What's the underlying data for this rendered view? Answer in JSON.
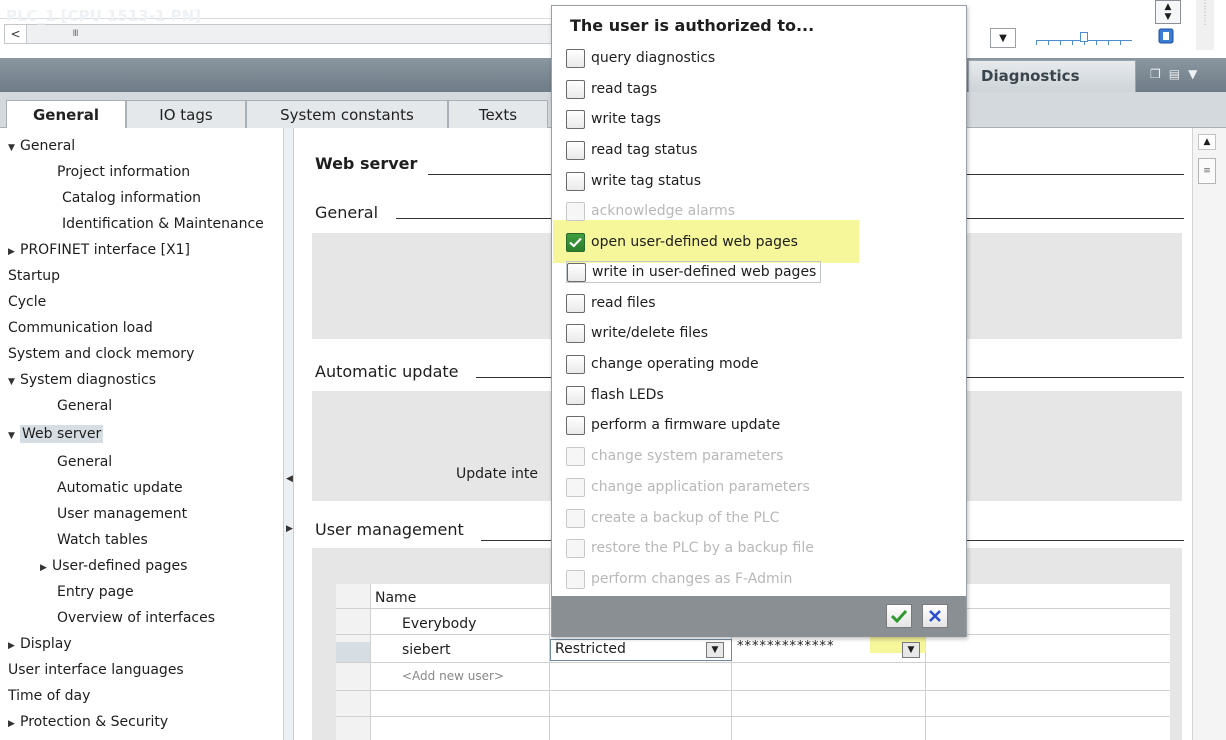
{
  "toolbar": {
    "scroll_left_glyph": "<",
    "scroll_thumb_glyph": "III"
  },
  "inspector": {
    "title": "PLC_1 [CPU 1513-1 PN]",
    "right_tab": "Diagnostics"
  },
  "tabs": [
    {
      "label": "General",
      "active": true
    },
    {
      "label": "IO tags",
      "active": false
    },
    {
      "label": "System constants",
      "active": false
    },
    {
      "label": "Texts",
      "active": false
    }
  ],
  "nav": {
    "items": [
      {
        "label": "General",
        "expander": "expanded"
      },
      {
        "label": "Project information"
      },
      {
        "label": "Catalog information"
      },
      {
        "label": "Identification & Maintenance"
      },
      {
        "label": "PROFINET interface [X1]",
        "expander": "collapsed"
      },
      {
        "label": "Startup"
      },
      {
        "label": "Cycle"
      },
      {
        "label": "Communication load"
      },
      {
        "label": "System and clock memory"
      },
      {
        "label": "System diagnostics",
        "expander": "expanded"
      },
      {
        "label": "General"
      },
      {
        "label": "Web server",
        "expander": "expanded",
        "selected": true
      },
      {
        "label": "General"
      },
      {
        "label": "Automatic update"
      },
      {
        "label": "User management"
      },
      {
        "label": "Watch tables"
      },
      {
        "label": "User-defined pages",
        "expander": "collapsed"
      },
      {
        "label": "Entry page"
      },
      {
        "label": "Overview of interfaces"
      },
      {
        "label": "Display",
        "expander": "collapsed"
      },
      {
        "label": "User interface languages"
      },
      {
        "label": "Time of day"
      },
      {
        "label": "Protection & Security",
        "expander": "collapsed"
      }
    ]
  },
  "content": {
    "web_server_heading": "Web server",
    "general_heading": "General",
    "automatic_update_heading": "Automatic update",
    "update_interval_label": "Update inte",
    "user_management_heading": "User management",
    "user_table": {
      "name_header": "Name",
      "rows": [
        {
          "name": "Everybody"
        },
        {
          "name": "siebert",
          "access_level": "Restricted",
          "password": "*************"
        },
        {
          "name": "<Add new user>"
        }
      ]
    }
  },
  "popup": {
    "title": "The user is authorized to...",
    "permissions": [
      {
        "label": "query diagnostics",
        "checked": false,
        "enabled": true
      },
      {
        "label": "read tags",
        "checked": false,
        "enabled": true
      },
      {
        "label": "write tags",
        "checked": false,
        "enabled": true
      },
      {
        "label": "read tag status",
        "checked": false,
        "enabled": true
      },
      {
        "label": "write tag status",
        "checked": false,
        "enabled": true
      },
      {
        "label": "acknowledge alarms",
        "checked": false,
        "enabled": false
      },
      {
        "label": "open user-defined web pages",
        "checked": true,
        "enabled": true
      },
      {
        "label": "write in user-defined web pages",
        "checked": false,
        "enabled": true
      },
      {
        "label": "read files",
        "checked": false,
        "enabled": true
      },
      {
        "label": "write/delete files",
        "checked": false,
        "enabled": true
      },
      {
        "label": "change operating mode",
        "checked": false,
        "enabled": true
      },
      {
        "label": "flash LEDs",
        "checked": false,
        "enabled": true
      },
      {
        "label": "perform a firmware update",
        "checked": false,
        "enabled": true
      },
      {
        "label": "change system parameters",
        "checked": false,
        "enabled": false
      },
      {
        "label": "change application parameters",
        "checked": false,
        "enabled": false
      },
      {
        "label": "create a backup of the PLC",
        "checked": false,
        "enabled": false
      },
      {
        "label": "restore the PLC by a backup file",
        "checked": false,
        "enabled": false
      },
      {
        "label": "perform changes as F-Admin",
        "checked": false,
        "enabled": false
      }
    ],
    "ok_icon": "checkmark-icon",
    "cancel_icon": "close-icon"
  },
  "colors": {
    "titlebar": "#7a8690",
    "highlight": "#f4f48a",
    "checked_green": "#2a7f2a",
    "cancel_blue": "#2a4ed0"
  }
}
